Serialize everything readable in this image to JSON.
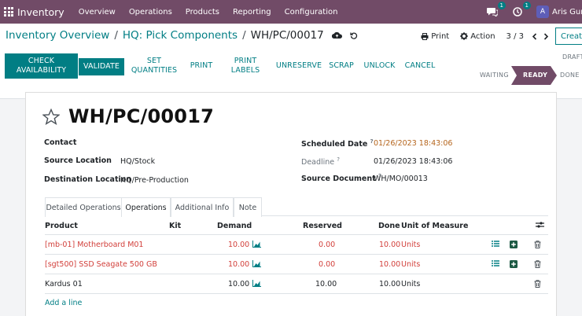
{
  "navbar": {
    "brand": "Inventory",
    "menu": [
      "Overview",
      "Operations",
      "Products",
      "Reporting",
      "Configuration"
    ],
    "messages_count": "1",
    "activities_count": "1",
    "avatar_letter": "A",
    "user_name": "Aris Gunt"
  },
  "breadcrumb": {
    "items": [
      "Inventory Overview",
      "HQ: Pick Components"
    ],
    "current": "WH/PC/00017"
  },
  "control": {
    "print": "Print",
    "action": "Action",
    "pager": "3 / 3",
    "create": "Create"
  },
  "buttons": {
    "check_availability": "CHECK AVAILABILITY",
    "validate": "VALIDATE",
    "set_quantities": "SET QUANTITIES",
    "print": "PRINT",
    "print_labels": "PRINT LABELS",
    "unreserve": "UNRESERVE",
    "scrap": "SCRAP",
    "unlock": "UNLOCK",
    "cancel": "CANCEL"
  },
  "status": {
    "draft": "DRAFT",
    "waiting": "WAITING",
    "ready": "READY",
    "done": "DONE",
    "ready_color": "#714b67"
  },
  "record": {
    "name": "WH/PC/00017",
    "contact_label": "Contact",
    "source_location_label": "Source Location",
    "source_location": "HQ/Stock",
    "destination_location_label": "Destination Location",
    "destination_location": "HQ/Pre-Production",
    "scheduled_date_label": "Scheduled Date",
    "scheduled_date": "01/26/2023 18:43:06",
    "deadline_label": "Deadline",
    "deadline": "01/26/2023 18:43:06",
    "source_document_label": "Source Document",
    "source_document": "WH/MO/00013",
    "help_mark": "?"
  },
  "tabs": [
    "Detailed Operations",
    "Operations",
    "Additional Info",
    "Note"
  ],
  "table": {
    "headers": {
      "product": "Product",
      "kit": "Kit",
      "demand": "Demand",
      "reserved": "Reserved",
      "done": "Done",
      "uom": "Unit of Measure"
    },
    "rows": [
      {
        "product": "[mb-01] Motherboard M01",
        "demand": "10.00",
        "reserved": "0.00",
        "done": "10.00",
        "uom": "Units"
      },
      {
        "product": "[sgt500] SSD Seagate 500 GB",
        "demand": "10.00",
        "reserved": "0.00",
        "done": "10.00",
        "uom": "Units"
      },
      {
        "product": "Kardus 01",
        "demand": "10.00",
        "reserved": "10.00",
        "done": "10.00",
        "uom": "Units"
      }
    ],
    "add_line": "Add a line"
  }
}
